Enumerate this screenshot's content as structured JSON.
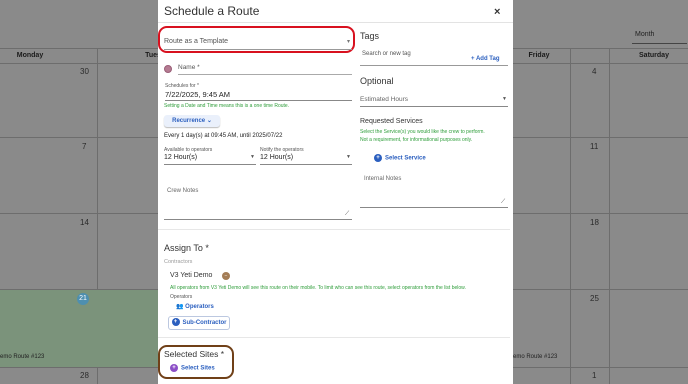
{
  "calendar": {
    "view_selector": "Month",
    "day_headers": [
      "Monday",
      "Tues",
      "Friday",
      "Saturday"
    ],
    "dates": [
      "30",
      "4",
      "7",
      "11",
      "14",
      "18",
      "21",
      "25",
      "28",
      "1"
    ],
    "events": [
      "emo Route #123",
      "emo Route #123"
    ]
  },
  "modal": {
    "title": "Schedule a Route",
    "close_icon": "×",
    "template_placeholder": "Route as a Template",
    "name_label": "Name *",
    "scheduled_for_label": "Schedules for *",
    "scheduled_for_value": "7/22/2025, 9:45 AM",
    "one_time_note": "Setting a Date and Time means this is a one time Route.",
    "recurrence_label": "Recurrence",
    "recurrence_summary": "Every 1 day(s) at 09:45 AM, until 2025/07/22",
    "available_label": "Available to operators",
    "available_value": "12 Hour(s)",
    "notify_label": "Notify the operators",
    "notify_value": "12 Hour(s)",
    "crew_notes_label": "Crew Notes",
    "tags_title": "Tags",
    "tag_search_placeholder": "Search or new tag",
    "add_tag_label": "+ Add Tag",
    "optional_title": "Optional",
    "estimated_hours_placeholder": "Estimated Hours",
    "requested_services_title": "Requested Services",
    "requested_services_note1": "Select the Service(s) you would like the crew to perform.",
    "requested_services_note2": "Not a requirement, for informational purposes only.",
    "select_service_label": "Select Service",
    "internal_notes_label": "Internal Notes",
    "assign_to_title": "Assign To *",
    "contractors_label": "Contractors",
    "contractor_name": "V3 Yeti Demo",
    "contractor_note": "All operators from V3 Yeti Demo will see this route on their mobile. To limit who can see this route, select operators from the list below.",
    "operators_label": "Operators",
    "operators_button": "Operators",
    "subcontractor_button": "Sub-Contractor",
    "selected_sites_title": "Selected Sites *",
    "select_sites_button": "Select Sites"
  },
  "colors": {
    "annotation_red": "#d8111f",
    "annotation_brown": "#704018",
    "link_blue": "#2b5fbf",
    "note_green": "#2e9d3a"
  }
}
